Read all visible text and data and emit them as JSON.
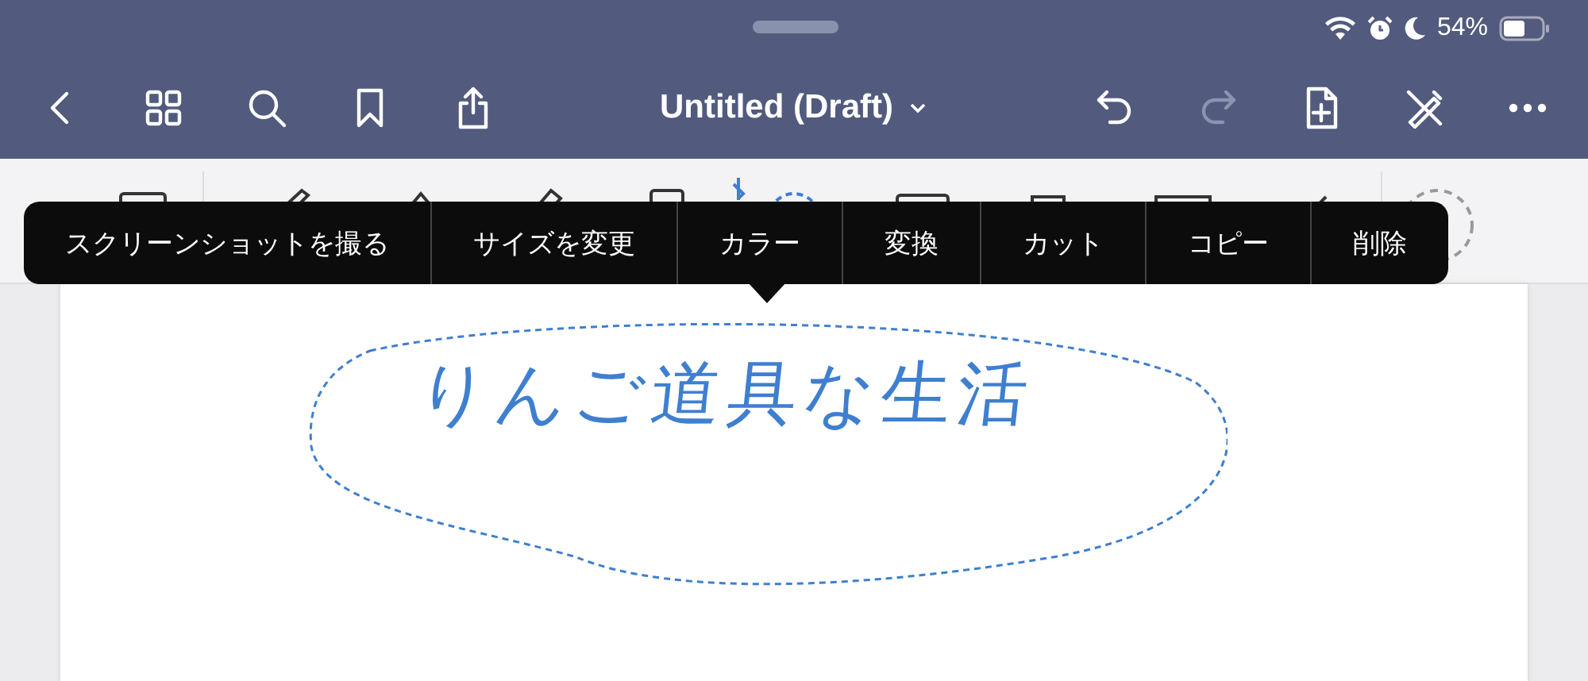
{
  "status_bar": {
    "battery": "54%"
  },
  "nav_bar": {
    "title": "Untitled (Draft)",
    "redo_disabled": true
  },
  "context_menu": {
    "items": [
      {
        "label": "スクリーンショットを撮る"
      },
      {
        "label": "サイズを変更"
      },
      {
        "label": "カラー"
      },
      {
        "label": "変換"
      },
      {
        "label": "カット"
      },
      {
        "label": "コピー"
      },
      {
        "label": "削除"
      }
    ]
  },
  "page": {
    "handwriting": "りんご道具な生活"
  }
}
